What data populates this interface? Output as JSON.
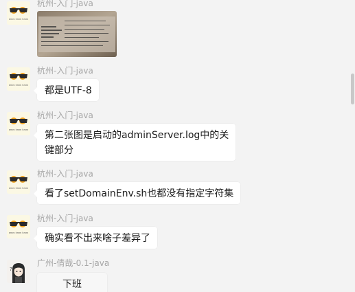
{
  "messages": [
    {
      "sender": "杭州-入门-java",
      "type": "image"
    },
    {
      "sender": "杭州-入门-java",
      "text": "都是UTF-8"
    },
    {
      "sender": "杭州-入门-java",
      "line1": "第二张图是启动的adminServer.log中的关",
      "line2": "键部分"
    },
    {
      "sender": "杭州-入门-java",
      "text": "看了setDomainEnv.sh也都没有指定字符集"
    },
    {
      "sender": "杭州-入门-java",
      "text": "确实看不出来啥子差异了"
    },
    {
      "sender": "广州-倩哉-0.1-java",
      "text": "下班"
    }
  ],
  "avatar_caption": "emm hmm hmm",
  "avatar_question_mark": "?"
}
